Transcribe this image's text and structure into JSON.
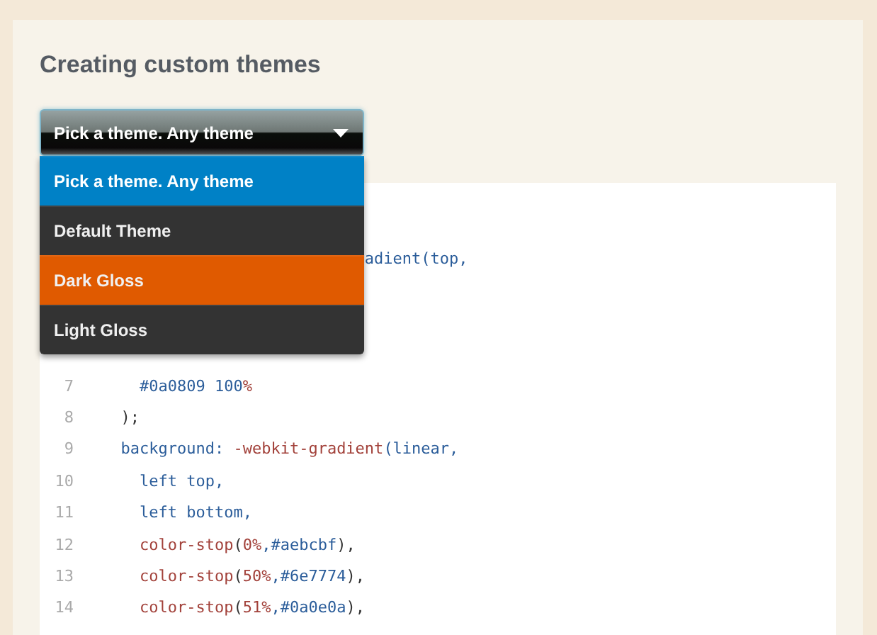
{
  "heading": "Creating custom themes",
  "select": {
    "value": "Pick a theme. Any theme",
    "expanded": true
  },
  "menu": {
    "items": [
      {
        "label": "Pick a theme. Any theme",
        "selected": true,
        "color": "#0081c6"
      },
      {
        "label": "Default Theme",
        "selected": false,
        "color": "#333333"
      },
      {
        "label": "Dark Gloss",
        "selected": false,
        "color": "#e05a00"
      },
      {
        "label": "Light Gloss",
        "selected": false,
        "color": "#333333"
      }
    ]
  },
  "code": {
    "lines": [
      {
        "tokens": [
          {
            "kind": "atom",
            "text": "                            adient(top,"
          }
        ]
      },
      {
        "number": "7",
        "tokens": [
          {
            "kind": "atom",
            "text": "    #0a0809 100"
          },
          {
            "kind": "fn",
            "text": "%"
          }
        ]
      },
      {
        "number": "8",
        "tokens": [
          {
            "kind": "plain",
            "text": "  );"
          }
        ]
      },
      {
        "number": "9",
        "tokens": [
          {
            "kind": "atom",
            "text": "  background:"
          },
          {
            "kind": "fn",
            "text": " -webkit-gradient"
          },
          {
            "kind": "atom",
            "text": "(linear,"
          }
        ]
      },
      {
        "number": "10",
        "tokens": [
          {
            "kind": "atom",
            "text": "    left top,"
          }
        ]
      },
      {
        "number": "11",
        "tokens": [
          {
            "kind": "atom",
            "text": "    left bottom,"
          }
        ]
      },
      {
        "number": "12",
        "tokens": [
          {
            "kind": "fn",
            "text": "    color-stop"
          },
          {
            "kind": "plain",
            "text": "("
          },
          {
            "kind": "fn",
            "text": "0%"
          },
          {
            "kind": "atom",
            "text": ",#aebcbf"
          },
          {
            "kind": "plain",
            "text": "),"
          }
        ]
      },
      {
        "number": "13",
        "tokens": [
          {
            "kind": "fn",
            "text": "    color-stop"
          },
          {
            "kind": "plain",
            "text": "("
          },
          {
            "kind": "fn",
            "text": "50%"
          },
          {
            "kind": "atom",
            "text": ",#6e7774"
          },
          {
            "kind": "plain",
            "text": "),"
          }
        ]
      },
      {
        "number": "14",
        "tokens": [
          {
            "kind": "fn",
            "text": "    color-stop"
          },
          {
            "kind": "plain",
            "text": "("
          },
          {
            "kind": "fn",
            "text": "51%"
          },
          {
            "kind": "atom",
            "text": ",#0a0e0a"
          },
          {
            "kind": "plain",
            "text": "),"
          }
        ]
      }
    ]
  }
}
